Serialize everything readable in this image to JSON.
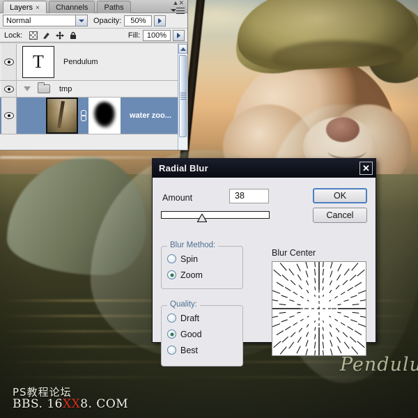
{
  "app": "Adobe Photoshop",
  "layers_panel": {
    "tabs": [
      {
        "label": "Layers",
        "close_glyph": "×",
        "active": true
      },
      {
        "label": "Channels",
        "active": false
      },
      {
        "label": "Paths",
        "active": false
      }
    ],
    "panel_menu_icon": "panel-menu-icon",
    "blend_mode": "Normal",
    "opacity_label": "Opacity:",
    "opacity_value": "50%",
    "fill_label": "Fill:",
    "fill_value": "100%",
    "lock_label": "Lock:",
    "lock_icons": [
      "lock-transparent-pixels-icon",
      "lock-image-pixels-icon",
      "lock-position-icon",
      "lock-all-icon"
    ],
    "selected_row_color": "#6b8bb5",
    "rows": [
      {
        "name": "Pendulum",
        "type": "text",
        "thumb_glyph": "T",
        "visible": true,
        "selected": false
      },
      {
        "name": "tmp",
        "type": "group",
        "visible": true,
        "selected": false,
        "expanded": true
      },
      {
        "name": "water zoo...",
        "type": "image-with-mask",
        "visible": true,
        "selected": true
      }
    ]
  },
  "dialog": {
    "title": "Radial Blur",
    "close_glyph": "✕",
    "amount_label": "Amount",
    "amount_value": "38",
    "slider_percent": 38,
    "ok_label": "OK",
    "cancel_label": "Cancel",
    "blur_method": {
      "legend": "Blur Method:",
      "options": [
        {
          "label": "Spin",
          "selected": false
        },
        {
          "label": "Zoom",
          "selected": true
        }
      ]
    },
    "quality": {
      "legend": "Quality:",
      "options": [
        {
          "label": "Draft",
          "selected": false
        },
        {
          "label": "Good",
          "selected": true
        },
        {
          "label": "Best",
          "selected": false
        }
      ]
    },
    "blur_center": {
      "label": "Blur Center",
      "pattern": "zoom-radial-lines"
    },
    "accent_radio_color": "#2e7a4e",
    "focus_border_color": "#4a7fc1"
  },
  "artwork": {
    "subject": "hamster wearing pirate hat over sunset sea",
    "signature": "Pendulu",
    "watermark_line1": "PS教程论坛",
    "watermark_line2_a": "BBS. 16",
    "watermark_line2_hl": "XX",
    "watermark_line2_b": "8. COM",
    "watermark_highlight_color": "#d83020"
  }
}
